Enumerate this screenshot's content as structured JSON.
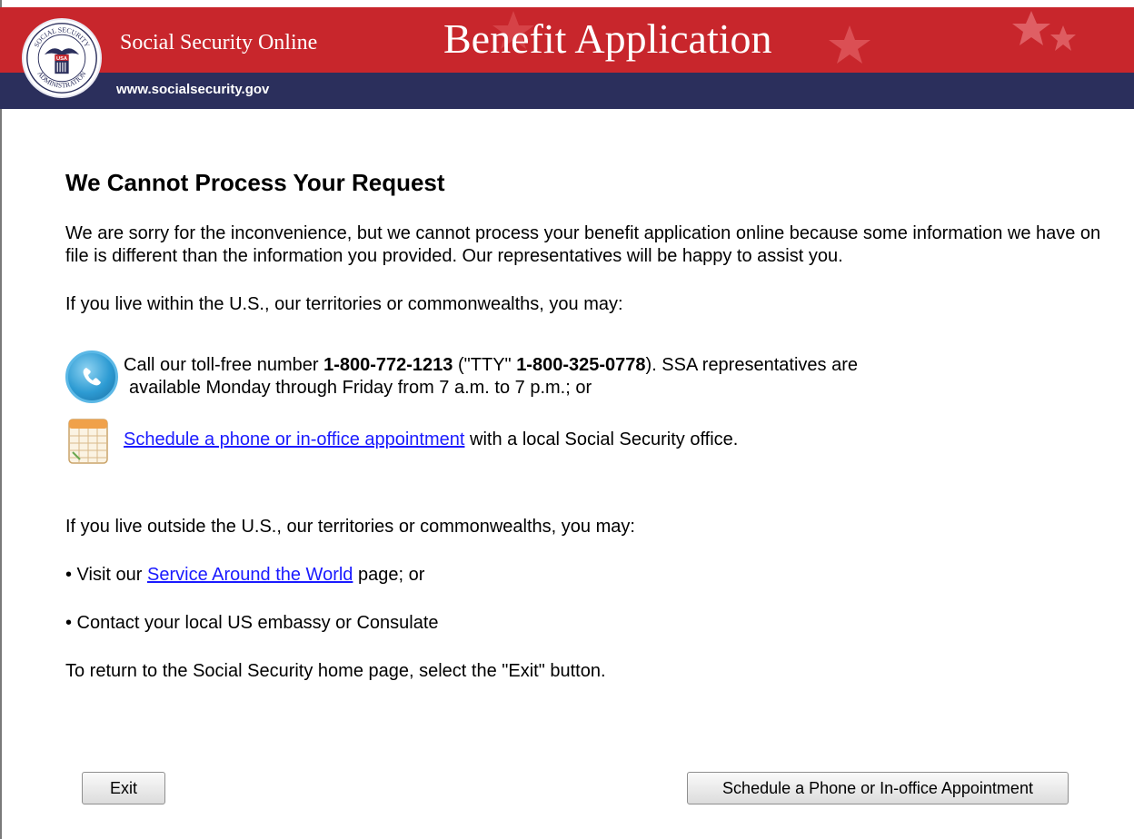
{
  "header": {
    "site_title": "Social Security Online",
    "page_banner_title": "Benefit Application",
    "site_url": "www.socialsecurity.gov",
    "seal_text_top": "SOCIAL SECURITY",
    "seal_text_bottom": "ADMINISTRATION",
    "seal_center": "USA",
    "colors": {
      "banner_red": "#c8262c",
      "banner_navy": "#2b2f5c"
    }
  },
  "main": {
    "heading": "We Cannot Process Your Request",
    "intro": "We are sorry for the inconvenience, but we cannot process your benefit application online because some information we have on file is different than the information you provided. Our representatives will be happy to assist you.",
    "us_options_intro": "If you live within the U.S., our territories or commonwealths, you may:",
    "phone_option": {
      "icon": "phone-icon",
      "prefix": "Call our toll-free number ",
      "number": "1-800-772-1213",
      "tty_open": " (\"TTY\" ",
      "tty_number": "1-800-325-0778",
      "tty_close": "). SSA representatives are",
      "line2": "available Monday through Friday from 7 a.m. to 7 p.m.; or"
    },
    "schedule_option": {
      "icon": "calendar-icon",
      "link_text": "Schedule a phone or in-office appointment",
      "suffix": " with a local Social Security office."
    },
    "outside_intro": "If you live outside the U.S., our territories or commonwealths, you may:",
    "bullet1": {
      "prefix": "• Visit our ",
      "link_text": "Service Around the World",
      "suffix": " page; or"
    },
    "bullet2": "• Contact your local US embassy or Consulate",
    "exit_instruction": "To return to the Social Security home page, select the \"Exit\" button."
  },
  "buttons": {
    "exit_label": "Exit",
    "appointment_label": "Schedule a Phone or In-office Appointment"
  },
  "colors": {
    "link": "#1a1aff"
  }
}
